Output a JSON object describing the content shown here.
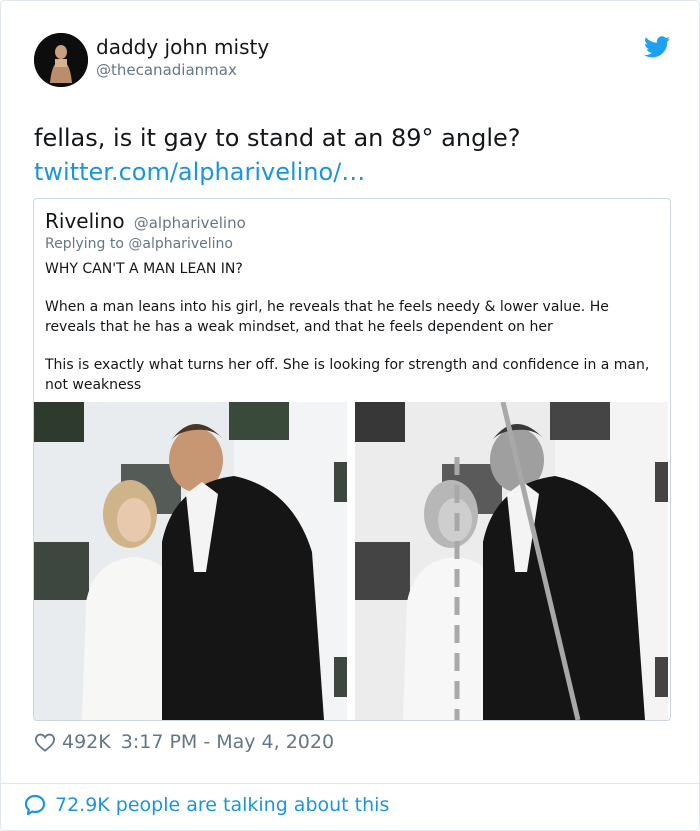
{
  "tweet": {
    "author_name": "daddy john misty",
    "author_handle": "@thecanadianmax",
    "text": "fellas, is it gay to stand at an 89° angle?",
    "link": "twitter.com/alpharivelino/…",
    "likes": "492K",
    "timestamp": "3:17 PM - May 4, 2020",
    "talking": "72.9K people are talking about this"
  },
  "quoted": {
    "name": "Rivelino",
    "handle": "@alpharivelino",
    "replying_to": "Replying to @alpharivelino",
    "paragraphs": [
      "WHY CAN'T A MAN LEAN IN?",
      "When a man leans into his girl, he reveals that he feels needy & lower value. He reveals that he has a weak mindset, and that he feels dependent on her",
      "This is exactly what turns her off. She is looking for strength and confidence in a man, not weakness"
    ]
  },
  "icons": {
    "bird": "twitter-bird-icon",
    "heart": "heart-outline-icon",
    "speech": "speech-bubble-icon"
  },
  "colors": {
    "link": "#1b95e0",
    "secondary_text": "#657786",
    "guide_line": "#22dd22"
  }
}
